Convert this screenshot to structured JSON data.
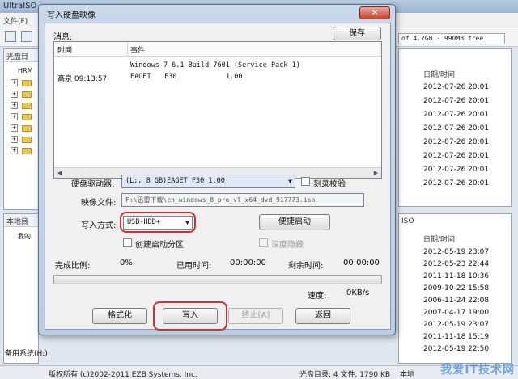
{
  "background": {
    "title": "UltraISO",
    "menu": {
      "file": "文件(F)"
    },
    "free_space": "of 4.7GB - 990MB free",
    "disc_dir_label": "光盘目",
    "local_dir_label": "本地目",
    "tree_items": [
      "HRM",
      "我的"
    ],
    "tree_bottom": "备用系统(H:)",
    "date_header": "日期/时间",
    "top_dates": [
      "2012-07-26 20:01",
      "2012-07-26 20:01",
      "2012-07-26 20:01",
      "2012-07-26 20:01",
      "2012-07-26 20:01",
      "2012-07-26 20:01",
      "2012-07-26 20:01",
      "2012-07-26 20:01"
    ],
    "bottom_dates": [
      "2012-05-19 23:07",
      "2012-05-23 22:44",
      "2011-11-18 10:36",
      "2009-10-22 15:58",
      "2006-11-24 22:08",
      "2007-04-17 19:00",
      "2012-05-19 23:07",
      "2011-11-18 15:19",
      "2012-05-19 22:50"
    ],
    "iso_label": "ISO",
    "status": {
      "copyright": "版权所有 (c)2002-2011 EZB Systems, Inc.",
      "disc_dir": "光盘目录: 4 文件, 1790 KB",
      "local_label": "本地"
    },
    "watermark": "我爱IT技术网"
  },
  "dialog": {
    "title": "写入硬盘映像",
    "close_symbol": "✕",
    "messages_label": "消息:",
    "save_button": "保存",
    "columns": {
      "time": "时间",
      "event": "事件"
    },
    "log": {
      "line1": "Windows 7 6.1 Build 7601 (Service Pack 1)",
      "time": "高泉 09:13:57",
      "device": "EAGET",
      "model": "F30",
      "version": "1.00"
    },
    "drive_label": "硬盘驱动器:",
    "drive_value": "(L:, 8 GB)EAGET   F30        1.00",
    "verify_label": "刻录校验",
    "image_label": "映像文件:",
    "image_path": "F:\\迅雷下载\\cn_windows_8_pro_vl_x64_dvd_917773.iso",
    "write_method_label": "写入方式:",
    "write_method_value": "USB-HDD+",
    "boot_button": "便捷启动",
    "create_partition_label": "创建启动分区",
    "hide_label": "深度隐藏",
    "progress_label": "完成比例:",
    "progress_value": "0%",
    "elapsed_label": "已用时间:",
    "elapsed_value": "00:00:00",
    "remaining_label": "剩余时间:",
    "remaining_value": "00:00:00",
    "progress_fraction": 0,
    "speed_label": "速度:",
    "speed_value": "0KB/s",
    "buttons": {
      "format": "格式化",
      "write": "写入",
      "stop": "终止[A]",
      "back": "返回"
    }
  }
}
